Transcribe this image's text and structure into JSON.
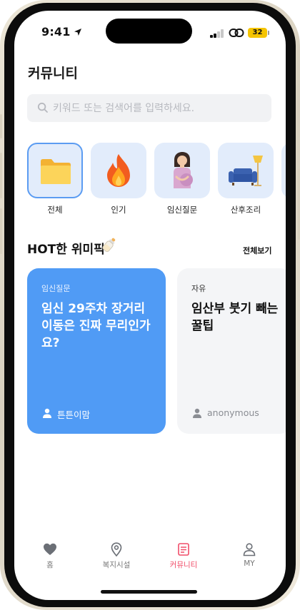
{
  "status_bar": {
    "time": "9:41",
    "battery": "32"
  },
  "header": {
    "title": "커뮤니티"
  },
  "search": {
    "placeholder": "키워드 또는 검색어를 입력하세요."
  },
  "categories": [
    {
      "label": "전체",
      "icon": "folder-icon",
      "selected": true
    },
    {
      "label": "인기",
      "icon": "fire-icon",
      "selected": false
    },
    {
      "label": "임신질문",
      "icon": "pregnant-woman-icon",
      "selected": false
    },
    {
      "label": "산후조리",
      "icon": "sofa-lamp-icon",
      "selected": false
    }
  ],
  "hot_section": {
    "title": "HOT한 위미픽",
    "see_all": "전체보기"
  },
  "cards": [
    {
      "tag": "임신질문",
      "title": "임신 29주차 장거리 이동은 진짜 무리인가요?",
      "author": "튼튼이맘"
    },
    {
      "tag": "자유",
      "title": "임산부 붓기 빼는 꿀팁",
      "author": "anonymous"
    }
  ],
  "tabbar": {
    "items": [
      {
        "label": "홈",
        "icon": "heart-icon"
      },
      {
        "label": "복지시설",
        "icon": "location-pin-icon"
      },
      {
        "label": "커뮤니티",
        "icon": "board-icon",
        "active": true
      },
      {
        "label": "MY",
        "icon": "person-icon"
      }
    ]
  },
  "colors": {
    "accent": "#509bf5",
    "active_tab": "#f14d69",
    "tile_bg": "#e2ecfb"
  }
}
